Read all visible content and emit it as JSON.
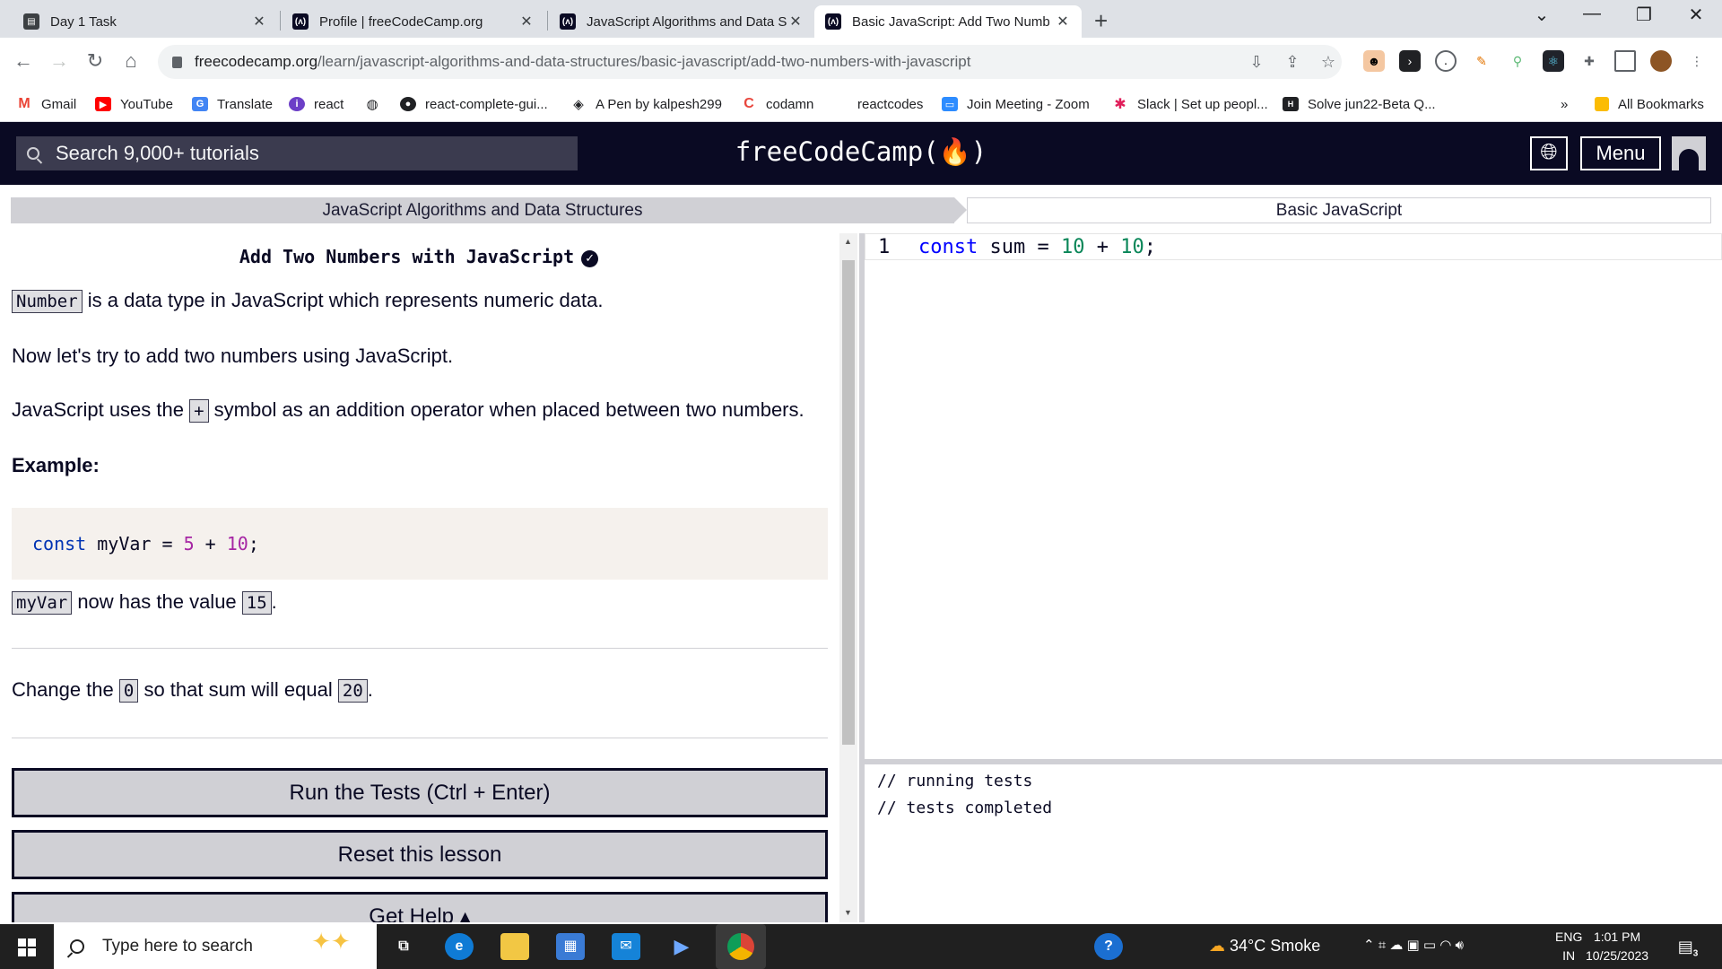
{
  "browser": {
    "tabs": [
      {
        "title": "Day 1 Task",
        "active": false
      },
      {
        "title": "Profile | freeCodeCamp.org",
        "active": false
      },
      {
        "title": "JavaScript Algorithms and Data S",
        "active": false
      },
      {
        "title": "Basic JavaScript: Add Two Numb",
        "active": true
      }
    ],
    "url_host": "freecodecamp.org",
    "url_path": "/learn/javascript-algorithms-and-data-structures/basic-javascript/add-two-numbers-with-javascript",
    "bookmarks": [
      "Gmail",
      "YouTube",
      "Translate",
      "react",
      "react-complete-gui...",
      "A Pen by kalpesh299",
      "codamn",
      "reactcodes",
      "Join Meeting - Zoom",
      "Slack | Set up peopl...",
      "Solve jun22-Beta Q..."
    ],
    "bookmarks_more": "»",
    "all_bookmarks": "All Bookmarks"
  },
  "nav": {
    "search_placeholder": "Search 9,000+ tutorials",
    "brand": "freeCodeCamp(🔥)",
    "menu_label": "Menu"
  },
  "breadcrumb": {
    "superblock": "JavaScript Algorithms and Data Structures",
    "block": "Basic JavaScript"
  },
  "challenge": {
    "title": "Add Two Numbers with JavaScript",
    "p1_code": "Number",
    "p1_text": " is a data type in JavaScript which represents numeric data.",
    "p2": "Now let's try to add two numbers using JavaScript.",
    "p3_before": "JavaScript uses the ",
    "p3_code": "+",
    "p3_after": " symbol as an addition operator when placed between two numbers.",
    "example_label": "Example:",
    "example_code": {
      "kw": "const",
      "name": " myVar = ",
      "a": "5",
      "op": " + ",
      "b": "10",
      "end": ";"
    },
    "p4_code1": "myVar",
    "p4_text": " now has the value ",
    "p4_code2": "15",
    "p4_end": ".",
    "task_before": "Change the ",
    "task_code1": "0",
    "task_mid": " so that sum will equal ",
    "task_code2": "20",
    "task_end": "."
  },
  "buttons": {
    "run": "Run the Tests (Ctrl + Enter)",
    "reset": "Reset this lesson",
    "help": "Get Help ▴"
  },
  "editor": {
    "line_number": "1",
    "code": {
      "kw": "const",
      "mid": " sum = ",
      "a": "10",
      "op": " + ",
      "b": "10",
      "end": ";"
    }
  },
  "console": [
    "// running tests",
    "// tests completed"
  ],
  "taskbar": {
    "search_placeholder": "Type here to search",
    "weather": "34°C  Smoke",
    "lang_top": "ENG",
    "lang_bottom": "IN",
    "time": "1:01 PM",
    "date": "10/25/2023",
    "notifications": "3"
  }
}
